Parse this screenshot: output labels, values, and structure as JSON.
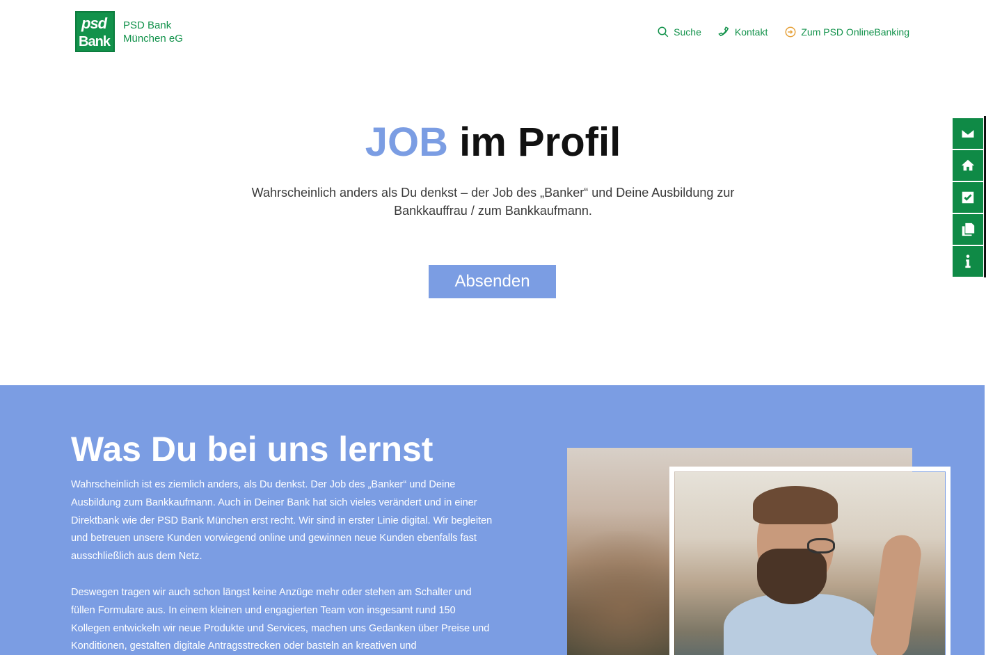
{
  "header": {
    "logo": {
      "mark_top": "psd",
      "mark_bottom": "Bank",
      "line1": "PSD Bank",
      "line2": "München eG"
    },
    "nav": [
      {
        "label": "Suche",
        "icon": "search-icon"
      },
      {
        "label": "Kontakt",
        "icon": "phone-icon"
      },
      {
        "label": "Zum PSD OnlineBanking",
        "icon": "login-icon"
      }
    ]
  },
  "hero": {
    "title_accent": "JOB",
    "title_rest": " im Profil",
    "subtitle": "Wahrscheinlich anders als Du denkst – der Job des „Banker“ und Deine Ausbildung zur Bankkauffrau / zum Bankkaufmann.",
    "button_label": "Absenden"
  },
  "sidebar": {
    "items": [
      {
        "icon": "envelope-icon"
      },
      {
        "icon": "home-icon"
      },
      {
        "icon": "checkbox-icon"
      },
      {
        "icon": "copy-icon"
      },
      {
        "icon": "info-icon"
      }
    ]
  },
  "section": {
    "heading": "Was Du bei uns lernst",
    "paragraph1": "Wahrscheinlich ist es ziemlich anders, als Du denkst. Der Job des „Banker“ und Deine Ausbildung zum Bankkaufmann. Auch in Deiner Bank hat sich vieles verändert und in einer Direktbank wie der PSD Bank München erst recht. Wir sind in erster Linie digital. Wir begleiten und betreuen unsere Kunden vorwiegend online und gewinnen neue Kunden ebenfalls fast ausschließlich aus dem Netz.",
    "paragraph2": "Deswegen tragen wir auch schon längst keine Anzüge mehr oder stehen am Schalter und füllen Formulare aus. In einem kleinen und engagierten Team von insgesamt rund 150 Kollegen entwickeln wir neue Produkte und Services, machen uns Gedanken über Preise und Konditionen, gestalten digitale Antragsstrecken oder basteln an kreativen und"
  },
  "colors": {
    "brand_green": "#12924b",
    "accent_blue": "#7b9de3"
  }
}
